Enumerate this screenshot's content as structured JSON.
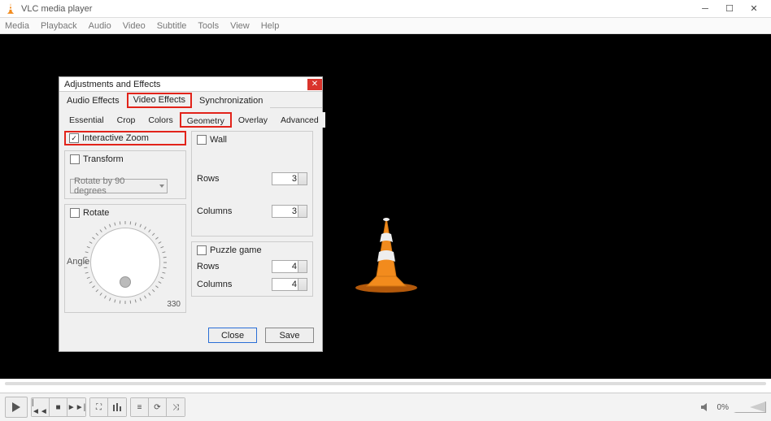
{
  "window": {
    "title": "VLC media player"
  },
  "menu": {
    "items": [
      "Media",
      "Playback",
      "Audio",
      "Video",
      "Subtitle",
      "Tools",
      "View",
      "Help"
    ]
  },
  "dialog": {
    "title": "Adjustments and Effects",
    "tabs1": {
      "items": [
        "Audio Effects",
        "Video Effects",
        "Synchronization"
      ],
      "selected": "Video Effects",
      "highlight": "Video Effects"
    },
    "tabs2": {
      "items": [
        "Essential",
        "Crop",
        "Colors",
        "Geometry",
        "Overlay",
        "Advanced"
      ],
      "selected": "Geometry",
      "highlight": "Geometry"
    },
    "geometry": {
      "interactive_zoom": {
        "label": "Interactive Zoom",
        "checked": true,
        "highlight": true
      },
      "transform": {
        "label": "Transform",
        "checked": false,
        "dropdown": "Rotate by 90 degrees"
      },
      "rotate": {
        "label": "Rotate",
        "checked": false,
        "angle_label": "Angle",
        "degrees_label": "330"
      },
      "wall": {
        "label": "Wall",
        "checked": false,
        "rows_label": "Rows",
        "rows": 3,
        "cols_label": "Columns",
        "cols": 3
      },
      "puzzle": {
        "label": "Puzzle game",
        "checked": false,
        "rows_label": "Rows",
        "rows": 4,
        "cols_label": "Columns",
        "cols": 4
      }
    },
    "buttons": {
      "close": "Close",
      "save": "Save"
    }
  },
  "controls": {
    "volume_pct": "0%"
  }
}
